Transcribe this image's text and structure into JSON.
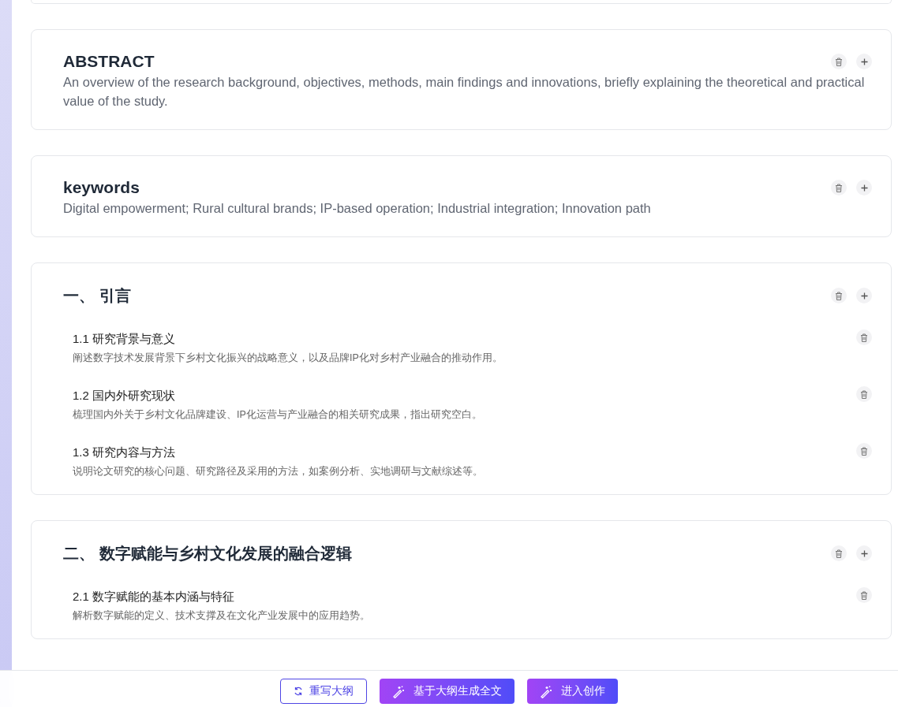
{
  "sections": [
    {
      "kind": "text",
      "title": "ABSTRACT",
      "body": "An overview of the research background, objectives, methods, main findings and innovations, briefly explaining the theoretical and practical value of the study."
    },
    {
      "kind": "text",
      "title": "keywords",
      "body": "Digital empowerment; Rural cultural brands; IP-based operation; Industrial integration; Innovation path"
    },
    {
      "kind": "outline",
      "title": "一、 引言",
      "items": [
        {
          "title": "1.1 研究背景与意义",
          "description": "阐述数字技术发展背景下乡村文化振兴的战略意义，以及品牌IP化对乡村产业融合的推动作用。"
        },
        {
          "title": "1.2 国内外研究现状",
          "description": "梳理国内外关于乡村文化品牌建设、IP化运营与产业融合的相关研究成果，指出研究空白。"
        },
        {
          "title": "1.3 研究内容与方法",
          "description": "说明论文研究的核心问题、研究路径及采用的方法，如案例分析、实地调研与文献综述等。"
        }
      ]
    },
    {
      "kind": "outline",
      "title": "二、 数字赋能与乡村文化发展的融合逻辑",
      "items": [
        {
          "title": "2.1 数字赋能的基本内涵与特征",
          "description": "解析数字赋能的定义、技术支撑及在文化产业发展中的应用趋势。"
        }
      ]
    }
  ],
  "actions": [
    {
      "kind": "outline",
      "label": "重写大纲"
    },
    {
      "kind": "gradient",
      "label": "基于大纲生成全文"
    },
    {
      "kind": "gradient",
      "label": "进入创作"
    }
  ]
}
